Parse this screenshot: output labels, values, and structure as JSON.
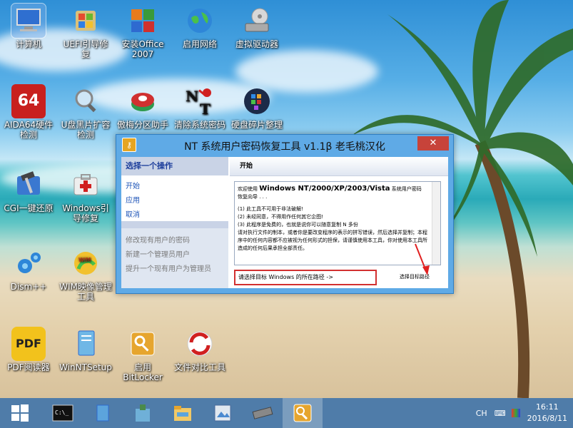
{
  "desktop": {
    "icons": [
      {
        "label": "计算机"
      },
      {
        "label": "UEFI引导修复"
      },
      {
        "label": "安装Office 2007"
      },
      {
        "label": "启用网络"
      },
      {
        "label": "虚拟驱动器"
      },
      {
        "label": "AIDA64硬件检测"
      },
      {
        "label": "U盘黑片扩容检测"
      },
      {
        "label": "傲梅分区助手"
      },
      {
        "label": "清除系统密码"
      },
      {
        "label": "硬盘碎片整理"
      },
      {
        "label": "CGI一键还原"
      },
      {
        "label": "Windows引导修复"
      },
      {
        "label": "Dism++"
      },
      {
        "label": "WIM映像管理工具"
      },
      {
        "label": "PDF阅读器"
      },
      {
        "label": "WinNTSetup"
      },
      {
        "label": "启用 BitLocker"
      },
      {
        "label": "文件对比工具"
      }
    ],
    "aida_text": "64",
    "pdf_text": "PDF"
  },
  "window": {
    "title": "NT 系统用户密码恢复工具 v1.1β 老毛桃汉化",
    "close_label": "✕",
    "left_header": "选择一个操作",
    "links": [
      "开始",
      "应用",
      "取消"
    ],
    "tasks": [
      "修改现有用户的密码",
      "新建一个管理员用户",
      "提升一个现有用户为管理员"
    ],
    "right_header": "开始",
    "textbox": {
      "line1": "欢迎使用",
      "line1_big": "Windows NT/2000/XP/2003/Vista",
      "line1_end": "系统用户密码",
      "line2": "恢复向导 . . .",
      "items": [
        "(1) 此工具不可用于非法破解!",
        "(2) 未经同意，不得用作任何其它企图!",
        "(3) 此程序是免费的，也就是说你可以随意复制 N 多份"
      ],
      "paragraph": "请对执行文件的制本，或者你是要改变程序的表示的拼写错误，然后选择并复制；本程序中的任何内容都不应被视为任何形式的担保，请谨慎使用本工具，你对使用本工具所造成的任何后果承担全部责任。"
    },
    "status_text": "请选择目标 Windows 的所在路径 ->",
    "browse_label": "选择目标路径"
  },
  "taskbar": {
    "tray_lang": "CH",
    "clock_time": "16:11",
    "clock_date": "2016/8/11"
  }
}
